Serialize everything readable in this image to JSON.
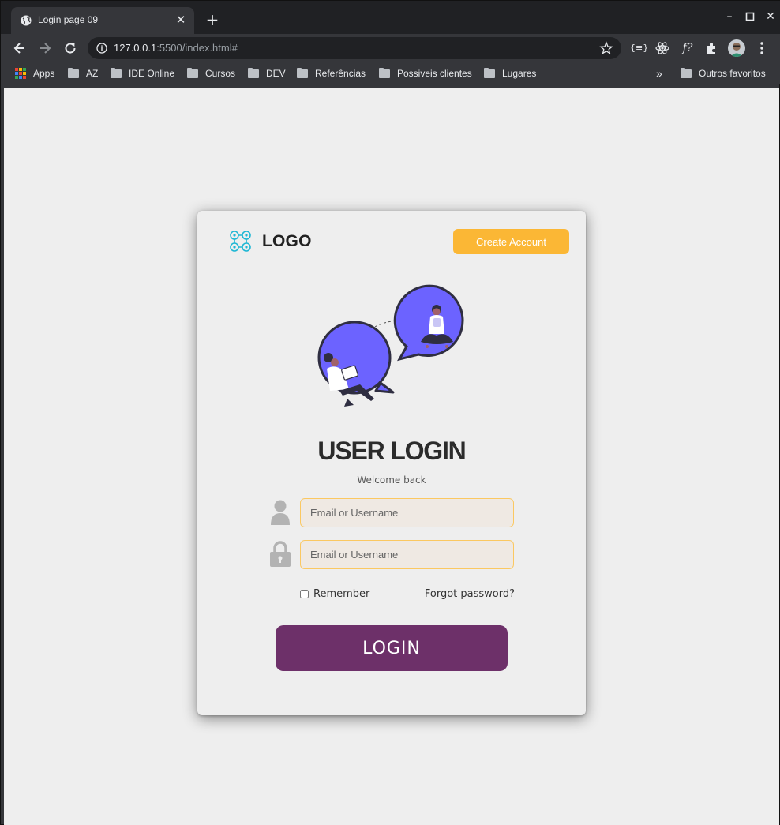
{
  "browser": {
    "tab_title": "Login page 09",
    "url_host": "127.0.0.1",
    "url_path": ":5500/index.html#",
    "bookmarks": [
      {
        "label": "Apps",
        "icon": "apps-grid-icon"
      },
      {
        "label": "AZ",
        "icon": "folder-icon"
      },
      {
        "label": "IDE Online",
        "icon": "folder-icon"
      },
      {
        "label": "Cursos",
        "icon": "folder-icon"
      },
      {
        "label": "DEV",
        "icon": "folder-icon"
      },
      {
        "label": "Referências",
        "icon": "folder-icon"
      },
      {
        "label": "Possiveis clientes",
        "icon": "folder-icon"
      },
      {
        "label": "Lugares",
        "icon": "folder-icon"
      }
    ],
    "overflow_label": "»",
    "other_bookmarks": "Outros favoritos"
  },
  "card": {
    "logo_text": "LOGO",
    "create_account": "Create Account",
    "title": "USER LOGIN",
    "subtitle": "Welcome back",
    "username_placeholder": "Email or Username",
    "password_placeholder": "Email or Username",
    "remember_label": "Remember",
    "forgot_label": "Forgot password?",
    "login_label": "LOGIN"
  },
  "colors": {
    "accent_orange": "#fbb735",
    "login_purple": "#6d3069",
    "illustration_blue": "#6c63ff",
    "page_bg": "#eeeeee"
  }
}
